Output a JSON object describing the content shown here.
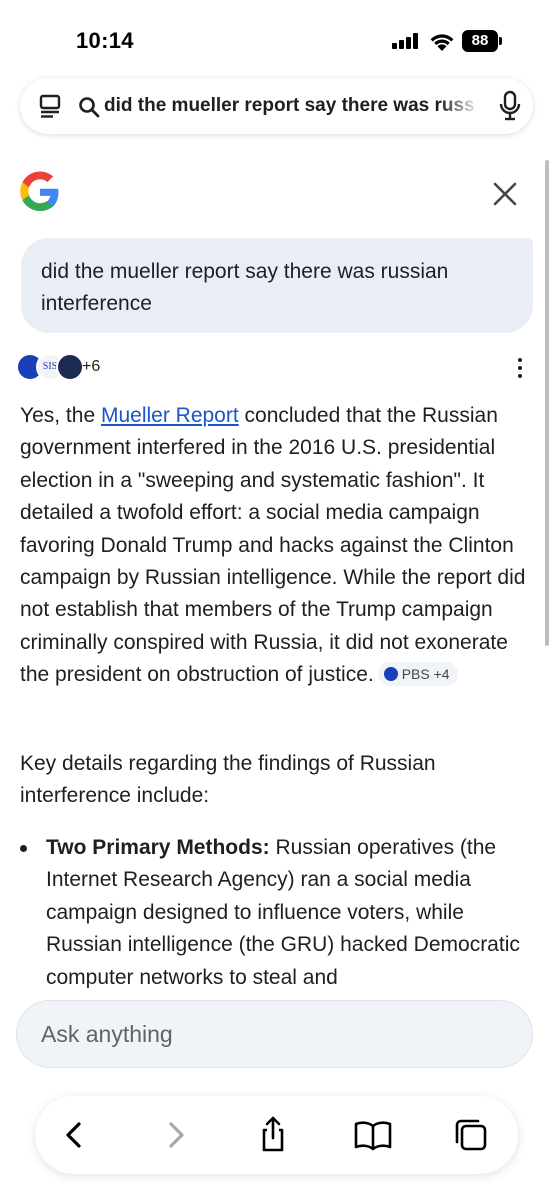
{
  "status_bar": {
    "time": "10:14",
    "battery": "88"
  },
  "url_bar": {
    "query": "did the mueller report say there was russi"
  },
  "query_bubble": {
    "text": "did the mueller report say there was russian interference"
  },
  "sources": {
    "icon_2_text": "SIS",
    "count": "+6"
  },
  "answer": {
    "part1": "Yes, the ",
    "link": "Mueller Report",
    "part2": " concluded that the Russian government interfered in the 2016 U.S. presidential election in a \"sweeping and systematic fashion\". It detailed a twofold effort: a social media campaign favoring Donald Trump and hacks against the Clinton campaign by Russian intelligence. While the report did not establish that members of the Trump campaign criminally conspired with Russia, it did not exonerate the president on obstruction of justice.",
    "citation": "PBS +4"
  },
  "key_details": "Key details regarding the findings of Russian interference include:",
  "bullets": [
    {
      "title": "Two Primary Methods:",
      "text": " Russian operatives (the Internet Research Agency) ran a social media campaign designed to influence voters, while Russian intelligence (the GRU) hacked Democratic computer networks to steal and"
    }
  ],
  "ask": {
    "placeholder": "Ask anything"
  },
  "colors": {
    "link": "#1a55c9",
    "bubble": "#e9eef6",
    "google_blue": "#4285F4",
    "google_red": "#EA4335",
    "google_yellow": "#FBBC05",
    "google_green": "#34A853"
  },
  "icons": [
    "menu-lines-icon",
    "search-icon",
    "mic-icon",
    "google-logo",
    "close-icon",
    "more-vert-icon",
    "back-icon",
    "forward-icon",
    "share-icon",
    "bookmarks-icon",
    "tabs-icon"
  ]
}
